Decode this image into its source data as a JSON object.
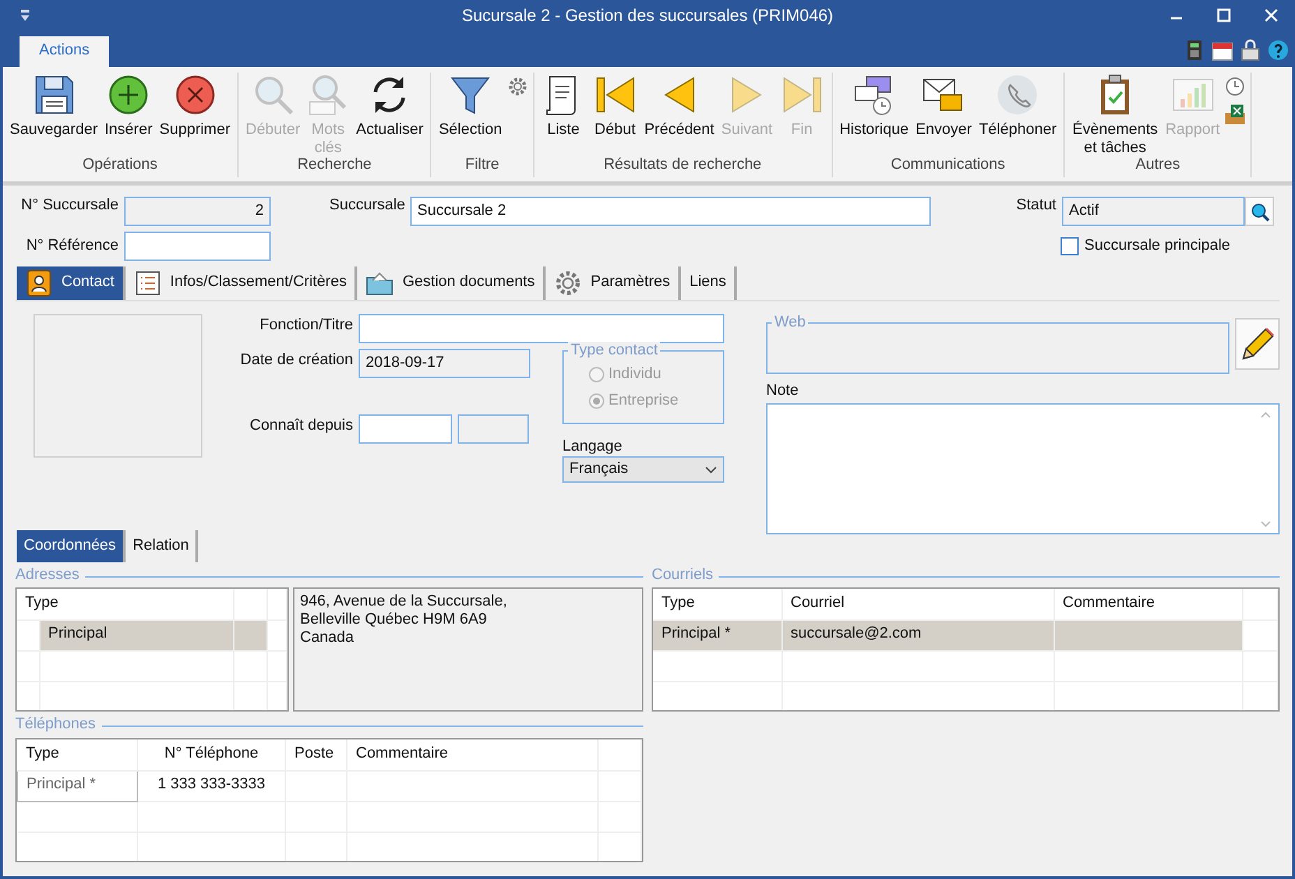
{
  "window": {
    "title": "Sucursale 2 - Gestion des succursales (PRIM046)"
  },
  "ribbon_tabs": [
    {
      "label": "Actions",
      "selected": true
    }
  ],
  "ribbon_groups": [
    {
      "label": "Opérations",
      "buttons": [
        {
          "kind": "save",
          "label": "Sauvegarder",
          "disabled": false
        },
        {
          "kind": "insert",
          "label": "Insérer",
          "disabled": false
        },
        {
          "kind": "delete",
          "label": "Supprimer",
          "disabled": false
        }
      ]
    },
    {
      "label": "Recherche",
      "buttons": [
        {
          "kind": "search",
          "label": "Débuter",
          "disabled": true
        },
        {
          "kind": "keywords",
          "label": "Mots clés",
          "disabled": true
        },
        {
          "kind": "refresh",
          "label": "Actualiser",
          "disabled": false
        }
      ]
    },
    {
      "label": "Filtre",
      "buttons": [
        {
          "kind": "filter",
          "label": "Sélection",
          "disabled": false
        }
      ],
      "small_buttons": [
        {
          "kind": "gear"
        }
      ]
    },
    {
      "label": "Résultats de recherche",
      "buttons": [
        {
          "kind": "list",
          "label": "Liste",
          "disabled": false
        },
        {
          "kind": "first",
          "label": "Début",
          "disabled": false
        },
        {
          "kind": "prev",
          "label": "Précédent",
          "disabled": false
        },
        {
          "kind": "next",
          "label": "Suivant",
          "disabled": true
        },
        {
          "kind": "last",
          "label": "Fin",
          "disabled": true
        }
      ]
    },
    {
      "label": "Communications",
      "buttons": [
        {
          "kind": "history",
          "label": "Historique",
          "disabled": false
        },
        {
          "kind": "mail",
          "label": "Envoyer",
          "disabled": false
        },
        {
          "kind": "phone",
          "label": "Téléphoner",
          "disabled": false
        }
      ]
    },
    {
      "label": "Autres",
      "buttons": [
        {
          "kind": "tasks",
          "label": "Évènements et tâches",
          "disabled": false
        },
        {
          "kind": "report",
          "label": "Rapport",
          "disabled": true
        }
      ],
      "small_buttons": [
        {
          "kind": "clock"
        },
        {
          "kind": "excel"
        }
      ]
    }
  ],
  "header": {
    "branch_no": {
      "label": "N° Succursale",
      "value": "2"
    },
    "reference_no": {
      "label": "N° Référence"
    },
    "branch": {
      "label": "Succursale",
      "value": "Succursale 2"
    },
    "status": {
      "label": "Statut",
      "value": "Actif"
    },
    "main_branch": {
      "label": "Succursale principale",
      "checked": false
    }
  },
  "tabs": [
    {
      "kind": "contact",
      "label": "Contact",
      "selected": true
    },
    {
      "kind": "list",
      "label": "Infos/Classement/Critères",
      "selected": false
    },
    {
      "kind": "folder",
      "label": "Gestion documents",
      "selected": false
    },
    {
      "kind": "gear",
      "label": "Paramètres",
      "selected": false
    },
    {
      "kind": "none",
      "label": "Liens",
      "selected": false
    }
  ],
  "contact": {
    "function": {
      "label": "Fonction/Titre"
    },
    "created": {
      "label": "Date de création",
      "value": "2018-09-17"
    },
    "known_since": {
      "label": "Connaît depuis"
    },
    "contact_type": {
      "legend": "Type contact",
      "disabled": true,
      "options": [
        {
          "label": "Individu",
          "selected": false
        },
        {
          "label": "Entreprise",
          "selected": true
        }
      ]
    },
    "language": {
      "label": "Langage",
      "value": "Français"
    },
    "web": {
      "legend": "Web"
    },
    "note": {
      "label": "Note"
    }
  },
  "sub_tabs": [
    {
      "label": "Coordonnées",
      "selected": true
    },
    {
      "label": "Relation",
      "selected": false
    }
  ],
  "addresses": {
    "legend": "Adresses",
    "columns": [
      "Type"
    ],
    "rows": [
      {
        "type": "Principal",
        "selected": true
      }
    ],
    "address_lines": [
      "946, Avenue de la Succursale,",
      "Belleville Québec H9M 6A9",
      "Canada"
    ]
  },
  "emails": {
    "legend": "Courriels",
    "columns": [
      "Type",
      "Courriel",
      "Commentaire"
    ],
    "rows": [
      {
        "cells": [
          "Principal *",
          "succursale@2.com"
        ],
        "selected": true
      }
    ]
  },
  "phones": {
    "legend": "Téléphones",
    "columns": [
      "Type",
      "N° Téléphone",
      "Poste",
      "Commentaire"
    ],
    "rows": [
      {
        "cells": [
          "Principal *",
          "1 333 333-3333"
        ],
        "selected": false
      }
    ]
  }
}
